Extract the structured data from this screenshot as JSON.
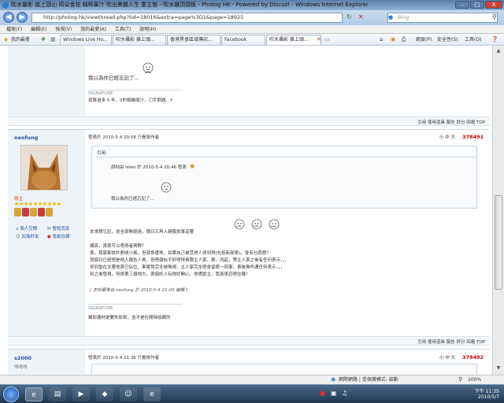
{
  "window": {
    "title": "吹水攝影 搶上頭山 四朵金花 純榨果汁 吹出美麗人生 重主態 - 吹水攝頂頭板 - Photog HK - Powered by Discuz! - Windows Internet Explorer",
    "minimize": "–",
    "maximize": "□",
    "close": "X"
  },
  "address": {
    "url": "http://photog.hk/viewthread.php?tid=18016&extra=page%3D1&page=18925",
    "search_placeholder": "Bing"
  },
  "menu": [
    "檔案(F)",
    "編輯(E)",
    "檢視(V)",
    "我的最愛(A)",
    "工具(T)",
    "說明(H)"
  ],
  "favorites": {
    "label": "我的最愛",
    "tabs": [
      "Windows Live Ho...",
      "吹水攝影 搶上頭...",
      "香港黑會區域傳記...",
      "Facebook",
      "吹水攝影 搶上頭..."
    ],
    "tools": [
      "網頁(P)",
      "安全性(S)",
      "工具(O)"
    ]
  },
  "post1": {
    "emoji_text": "我以為你已經忘記了...",
    "signature_label": "SIGNATURE",
    "signature": "就算過多 5 年、0的相機壞汁，刀手問題、Y",
    "actions": "引用 使用道具 報告 評分 回複 TOP"
  },
  "post2": {
    "author": "neofung",
    "meta": "發表於 2010-5-4 20:58  只看該作者",
    "font_size": "小 中 大",
    "floor": "378491",
    "role": "版主",
    "links": [
      "個人空間",
      "發短消息",
      "加為好友",
      "當前在線"
    ],
    "quote_label": "引用:",
    "quote_by": "原帖由 leleo 於 2010-5-4 20:46 發表",
    "quote_text": "我以為你已經忘記了...",
    "body_line1": "本來想忘記，會全部無經過，傳日又再入鏈服放事這著",
    "body_lines": [
      "講真，真係可以唔得者無野？",
      "係，我家都放計劃或小氣，但就身邊地，如果自己被其他人得到得(包括新部哥)，會有乜感想？",
      "我個日已經想是他人報告人員，但唔個似乎好唔得員跟主人家，算，改起，等主人家之後有任何表示，，，",
      "但到當在太著他首已佔位，事實我完全被無視，主人家完全唔會留係一回事，事後無件通任何表示，，，",
      "到之後發現，但係第三個地方，周個託人玩得好開心，他嗜版主，我真係忍唔住囉！"
    ],
    "edit_note": "[ 本帖最後由 neofung 於 2010-5-4 21:00 編輯 ]",
    "signature_label": "SIGNATURE",
    "signature": "攝影器材是要失影相，並不是在閒時收藏的",
    "actions": "引用 使用道具 報告 評分 回複 TOP"
  },
  "post3": {
    "author": "s2000",
    "role": "嘎嘎嘎",
    "meta": "發表於 2010-5-4 21:36  只看該作者",
    "font_size": "小 中 大",
    "floor": "378492"
  },
  "statusbar": {
    "zone": "網際網路 | 受保護模式: 啟動",
    "zoom": "100%"
  },
  "taskbar": {
    "time": "下午 11:35",
    "date": "2010/5/7"
  }
}
